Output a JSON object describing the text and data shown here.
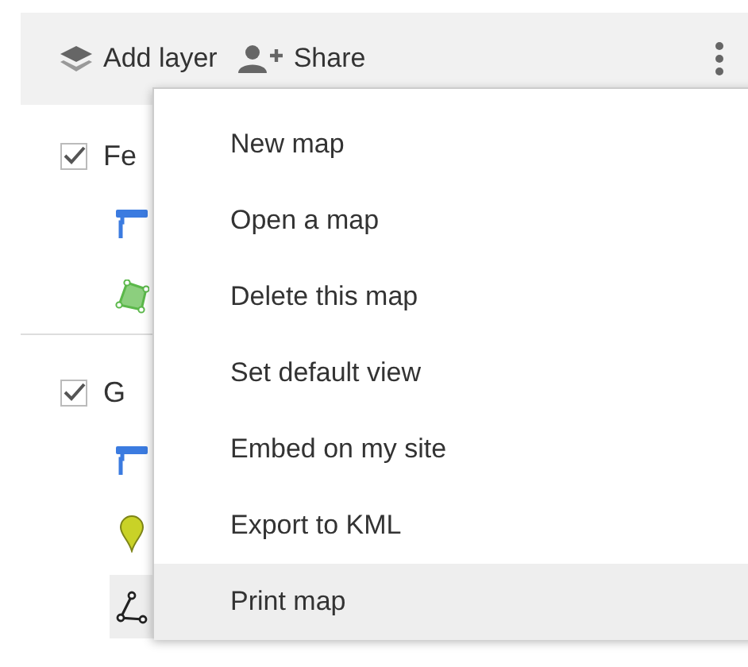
{
  "toolbar": {
    "buttons": [
      {
        "kind": "layers",
        "label": "Add layer"
      },
      {
        "kind": "share",
        "label": "Share"
      }
    ]
  },
  "layers": [
    {
      "name": "Fe",
      "checked": true,
      "items": [
        {
          "kind": "style"
        },
        {
          "kind": "polygon"
        }
      ]
    },
    {
      "name": "G",
      "checked": true,
      "items": [
        {
          "kind": "style"
        },
        {
          "kind": "pin"
        },
        {
          "kind": "line",
          "selected": true
        }
      ]
    }
  ],
  "menu": {
    "items": [
      {
        "label": "New map",
        "selected": false
      },
      {
        "label": "Open a map",
        "selected": false
      },
      {
        "label": "Delete this map",
        "selected": false
      },
      {
        "label": "Set default view",
        "selected": false
      },
      {
        "label": "Embed on my site",
        "selected": false
      },
      {
        "label": "Export to KML",
        "selected": false
      },
      {
        "label": "Print map",
        "selected": true
      }
    ]
  }
}
